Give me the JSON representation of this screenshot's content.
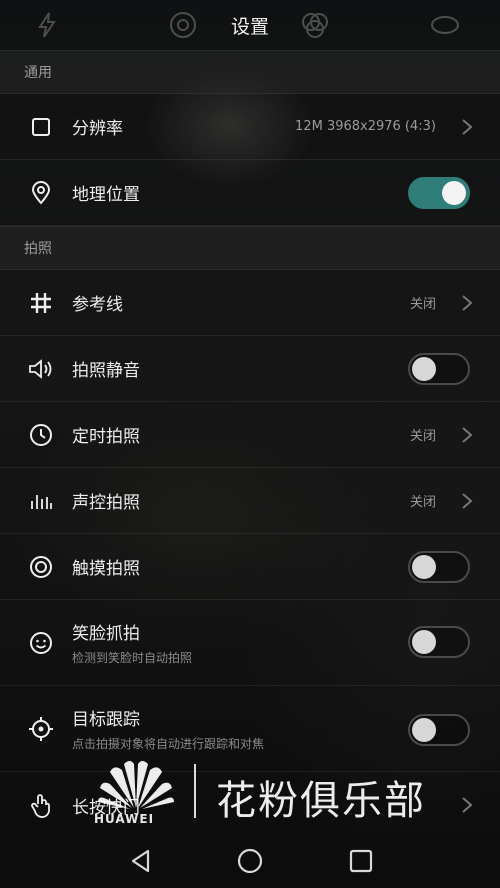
{
  "header": {
    "title": "设置"
  },
  "sections": {
    "general": "通用",
    "photo": "拍照"
  },
  "rows": {
    "resolution": {
      "label": "分辨率",
      "value": "12M 3968x2976 (4:3)"
    },
    "location": {
      "label": "地理位置",
      "toggle": "on"
    },
    "gridlines": {
      "label": "参考线",
      "value": "关闭"
    },
    "mute": {
      "label": "拍照静音",
      "toggle": "off"
    },
    "timer": {
      "label": "定时拍照",
      "value": "关闭"
    },
    "audio_control": {
      "label": "声控拍照",
      "value": "关闭"
    },
    "touch": {
      "label": "触摸拍照",
      "toggle": "off"
    },
    "smile": {
      "label": "笑脸抓拍",
      "sub": "检测到笑脸时自动拍照",
      "toggle": "off"
    },
    "tracking": {
      "label": "目标跟踪",
      "sub": "点击拍摄对象将自动进行跟踪和对焦",
      "toggle": "off"
    },
    "long_press": {
      "label": "长按快门"
    }
  },
  "watermark": {
    "brand": "花粉俱乐部",
    "logo_text": "HUAWEI"
  },
  "colors": {
    "accent": "#2e7d78",
    "background": "#111213"
  }
}
